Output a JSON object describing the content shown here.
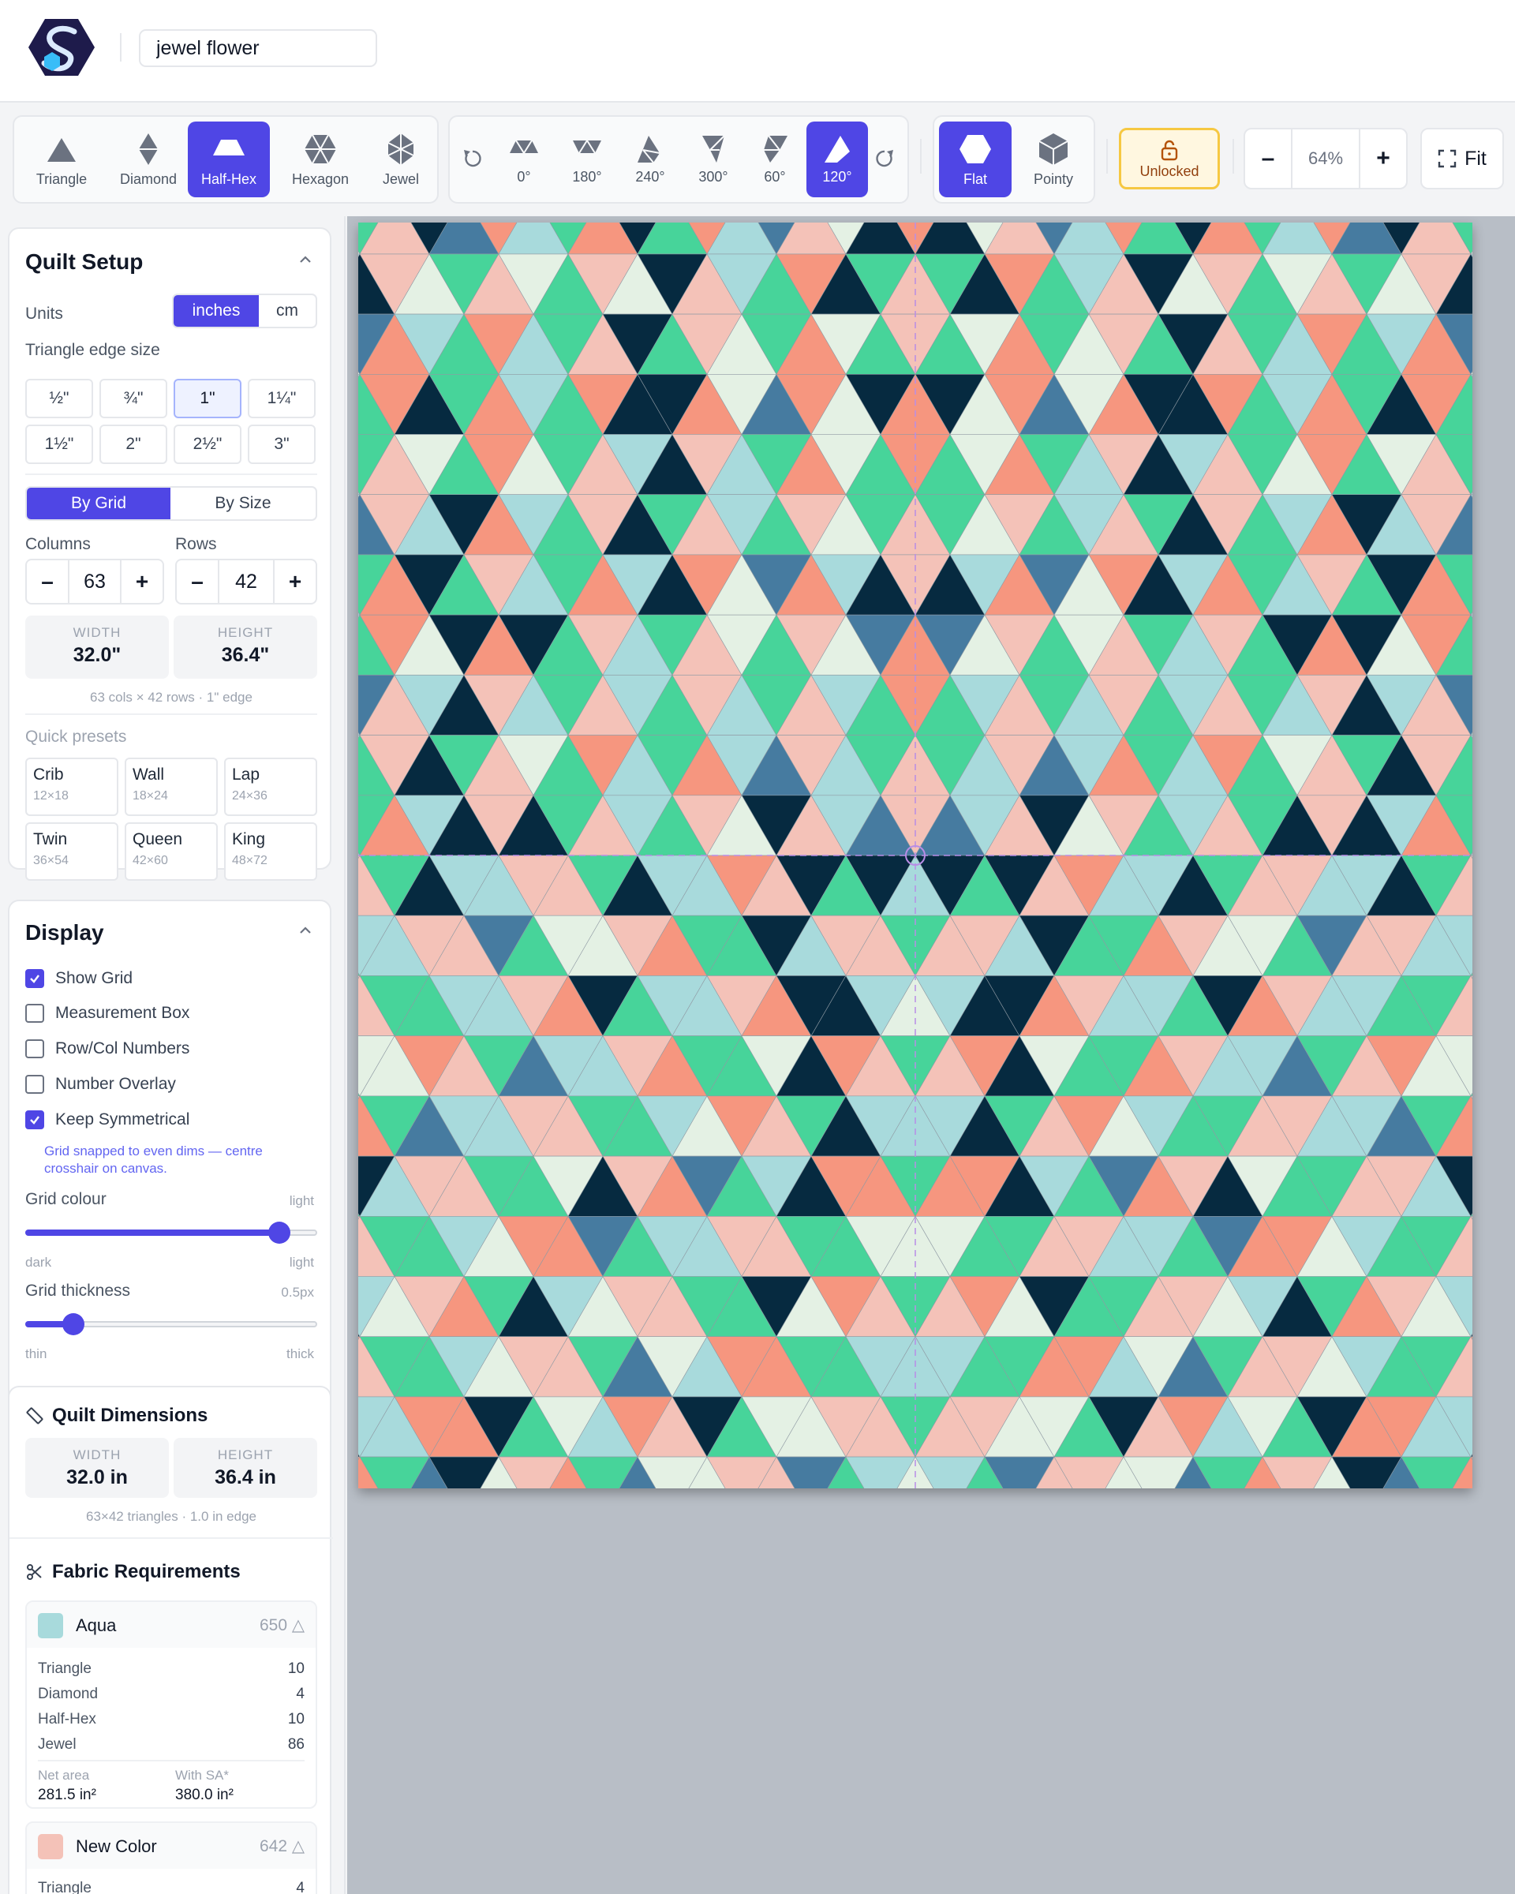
{
  "app": {
    "logo": "logo-hexagon-s",
    "project_name": "jewel flower"
  },
  "shapes": [
    {
      "label": "Triangle",
      "icon": "triangle-icon",
      "active": false
    },
    {
      "label": "Diamond",
      "icon": "diamond-icon",
      "active": false
    },
    {
      "label": "Half-Hex",
      "icon": "half-hex-icon",
      "active": true
    },
    {
      "label": "Hexagon",
      "icon": "hexagon-icon",
      "active": false
    },
    {
      "label": "Jewel",
      "icon": "jewel-icon",
      "active": false
    }
  ],
  "rotations": [
    {
      "label": "0°",
      "active": false
    },
    {
      "label": "180°",
      "active": false
    },
    {
      "label": "240°",
      "active": false
    },
    {
      "label": "300°",
      "active": false
    },
    {
      "label": "60°",
      "active": false
    },
    {
      "label": "120°",
      "active": true
    }
  ],
  "orientation": {
    "flat_label": "Flat",
    "pointy_label": "Pointy",
    "active": "Flat"
  },
  "lock": {
    "label": "Unlocked"
  },
  "zoom": {
    "minus": "–",
    "value": "64%",
    "plus": "+"
  },
  "fit": {
    "label": "Fit"
  },
  "setup": {
    "title": "Quilt Setup",
    "units_label": "Units",
    "units": [
      "inches",
      "cm"
    ],
    "units_active": "inches",
    "edge_label": "Triangle edge size",
    "edge_sizes": [
      "½\"",
      "¾\"",
      "1\"",
      "1¼\"",
      "1½\"",
      "2\"",
      "2½\"",
      "3\""
    ],
    "edge_active": "1\"",
    "modes": [
      "By Grid",
      "By Size"
    ],
    "mode_active": "By Grid",
    "columns_label": "Columns",
    "rows_label": "Rows",
    "columns": "63",
    "rows": "42",
    "minus": "–",
    "plus": "+",
    "width_label": "WIDTH",
    "width_value": "32.0\"",
    "height_label": "HEIGHT",
    "height_value": "36.4\"",
    "summary": "63 cols × 42 rows · 1\" edge",
    "presets_label": "Quick presets",
    "presets": [
      {
        "name": "Crib",
        "size": "12×18"
      },
      {
        "name": "Wall",
        "size": "18×24"
      },
      {
        "name": "Lap",
        "size": "24×36"
      },
      {
        "name": "Twin",
        "size": "36×54"
      },
      {
        "name": "Queen",
        "size": "42×60"
      },
      {
        "name": "King",
        "size": "48×72"
      }
    ]
  },
  "display": {
    "title": "Display",
    "options": [
      {
        "label": "Show Grid",
        "checked": true
      },
      {
        "label": "Measurement Box",
        "checked": false
      },
      {
        "label": "Row/Col Numbers",
        "checked": false
      },
      {
        "label": "Number Overlay",
        "checked": false
      },
      {
        "label": "Keep Symmetrical",
        "checked": true
      }
    ],
    "symmetry_note": "Grid snapped to even dims — centre crosshair on canvas.",
    "grid_colour_label": "Grid colour",
    "grid_colour_value": "light",
    "grid_colour_min": "dark",
    "grid_colour_max": "light",
    "grid_colour_level": 0.87,
    "grid_thickness_label": "Grid thickness",
    "grid_thickness_value": "0.5px",
    "grid_thickness_min": "thin",
    "grid_thickness_max": "thick",
    "grid_thickness_level": 0.16
  },
  "dimensions": {
    "title": "Quilt Dimensions",
    "width_label": "WIDTH",
    "width_value": "32.0 in",
    "height_label": "HEIGHT",
    "height_value": "36.4 in",
    "summary": "63×42 triangles · 1.0 in edge"
  },
  "fabric": {
    "title": "Fabric Requirements",
    "items": [
      {
        "name": "Aqua",
        "color": "#a8dadc",
        "count": "650 △",
        "rows": [
          {
            "label": "Triangle",
            "value": "10"
          },
          {
            "label": "Diamond",
            "value": "4"
          },
          {
            "label": "Half-Hex",
            "value": "10"
          },
          {
            "label": "Jewel",
            "value": "86"
          }
        ],
        "net_label": "Net area",
        "net_value": "281.5 in²",
        "sa_label": "With SA*",
        "sa_value": "380.0 in²"
      },
      {
        "name": "New Color",
        "color": "#f4c2b8",
        "count": "642 △",
        "rows": [
          {
            "label": "Triangle",
            "value": "4"
          }
        ]
      }
    ]
  },
  "palette": {
    "aqua": "#a8dadc",
    "blush": "#f4c2b8",
    "navy": "#062a40",
    "green": "#47d49a",
    "mint": "#e4f1e4",
    "salmon": "#f6967f",
    "steel": "#467ba0",
    "accent": "#4f46e5",
    "gridline": "#8f9aa3",
    "crosshair": "#b88de6"
  }
}
